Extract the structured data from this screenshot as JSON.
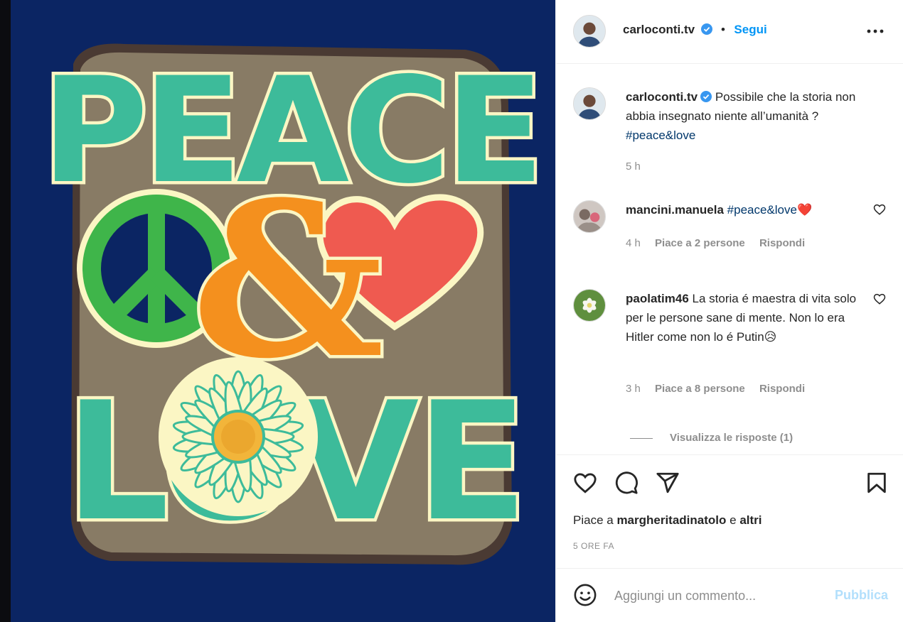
{
  "post": {
    "author": "carloconti.tv",
    "follow_label": "Segui",
    "separator": "•",
    "caption_text": "Possibile che la storia non abbia insegnato niente all’umanità ?",
    "caption_hashtag": "#peace&love",
    "caption_time": "5 h",
    "likes_prefix": "Piace a",
    "likes_user": "margheritadinatolo",
    "likes_and": "e",
    "likes_others": "altri",
    "timestamp": "5 ORE FA"
  },
  "comments": [
    {
      "user": "mancini.manuela",
      "hashtag": "#peace&love",
      "emoji": "❤️",
      "time": "4 h",
      "likes": "Piace a 2 persone",
      "reply_label": "Rispondi"
    },
    {
      "user": "paolatim46",
      "text": "La storia é maestra di vita solo per le persone sane di mente. Non lo era Hitler come non lo é Putin",
      "emoji": "😥",
      "time": "3 h",
      "likes": "Piace a 8 persone",
      "reply_label": "Rispondi",
      "view_replies": "Visualizza le risposte (1)"
    }
  ],
  "composer": {
    "placeholder": "Aggiungi un commento...",
    "publish_label": "Pubblica"
  },
  "artwork": {
    "word_top": "PEACE",
    "word_bottom": "LOVE",
    "ampersand": "&"
  },
  "colors": {
    "link_blue": "#0095f6",
    "hashtag_blue": "#00376b",
    "muted_gray": "#8e8e8e",
    "publish_disabled": "#b2dffc",
    "artwork_bg": "#0b2563",
    "teal": "#3dbb9a",
    "peace_green": "#3fb54a",
    "orange": "#f4901e",
    "heart_red": "#ef5a50",
    "cream": "#fbf6c4"
  },
  "icons": [
    "verified-icon",
    "more-options-icon",
    "heart-icon",
    "comment-icon",
    "share-icon",
    "bookmark-icon",
    "emoji-icon"
  ]
}
